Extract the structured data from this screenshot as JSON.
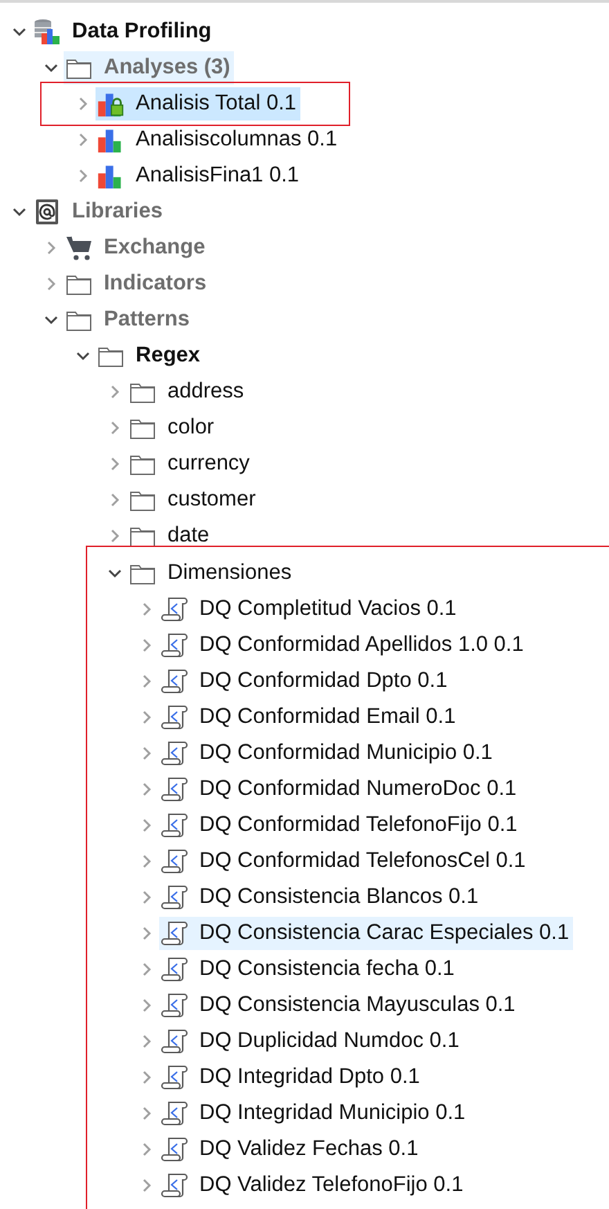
{
  "tree": [
    {
      "label": "Data Profiling",
      "kind": "profiling",
      "bold": true,
      "dimmed": false,
      "expanded": true,
      "selected": false,
      "hovered": false,
      "outlined": false,
      "children": [
        {
          "label": "Analyses (3)",
          "kind": "folder",
          "bold": true,
          "dimmed": true,
          "expanded": true,
          "selected": false,
          "hovered": true,
          "outlined": false,
          "children": [
            {
              "label": "Analisis Total 0.1",
              "kind": "analysis",
              "locked": true,
              "bold": false,
              "dimmed": false,
              "expanded": false,
              "selected": true,
              "hovered": false,
              "outlined": true
            },
            {
              "label": "Analisiscolumnas 0.1",
              "kind": "analysis",
              "locked": false,
              "bold": false,
              "dimmed": false,
              "expanded": false,
              "selected": false,
              "hovered": false,
              "outlined": false
            },
            {
              "label": "AnalisisFina1 0.1",
              "kind": "analysis",
              "locked": false,
              "bold": false,
              "dimmed": false,
              "expanded": false,
              "selected": false,
              "hovered": false,
              "outlined": false
            }
          ]
        }
      ]
    },
    {
      "label": "Libraries",
      "kind": "library",
      "bold": true,
      "dimmed": true,
      "expanded": true,
      "selected": false,
      "hovered": false,
      "outlined": false,
      "children": [
        {
          "label": "Exchange",
          "kind": "cart",
          "bold": true,
          "dimmed": true,
          "expanded": false,
          "selected": false,
          "hovered": false,
          "outlined": false
        },
        {
          "label": "Indicators",
          "kind": "folder",
          "bold": true,
          "dimmed": true,
          "expanded": false,
          "selected": false,
          "hovered": false,
          "outlined": false
        },
        {
          "label": "Patterns",
          "kind": "folder",
          "bold": true,
          "dimmed": true,
          "expanded": true,
          "selected": false,
          "hovered": false,
          "outlined": false,
          "children": [
            {
              "label": "Regex",
              "kind": "folder",
              "bold": true,
              "dimmed": false,
              "expanded": true,
              "selected": false,
              "hovered": false,
              "outlined": false,
              "children": [
                {
                  "label": "address",
                  "kind": "folder",
                  "bold": false,
                  "dimmed": false,
                  "expanded": false,
                  "selected": false,
                  "hovered": false,
                  "outlined": false
                },
                {
                  "label": "color",
                  "kind": "folder",
                  "bold": false,
                  "dimmed": false,
                  "expanded": false,
                  "selected": false,
                  "hovered": false,
                  "outlined": false
                },
                {
                  "label": "currency",
                  "kind": "folder",
                  "bold": false,
                  "dimmed": false,
                  "expanded": false,
                  "selected": false,
                  "hovered": false,
                  "outlined": false
                },
                {
                  "label": "customer",
                  "kind": "folder",
                  "bold": false,
                  "dimmed": false,
                  "expanded": false,
                  "selected": false,
                  "hovered": false,
                  "outlined": false
                },
                {
                  "label": "date",
                  "kind": "folder",
                  "bold": false,
                  "dimmed": false,
                  "expanded": false,
                  "selected": false,
                  "hovered": false,
                  "outlined": false
                },
                {
                  "label": "Dimensiones",
                  "kind": "folder",
                  "bold": false,
                  "dimmed": false,
                  "expanded": true,
                  "selected": false,
                  "hovered": false,
                  "outlined": true,
                  "children": [
                    {
                      "label": "DQ Completitud Vacios 0.1",
                      "kind": "pattern",
                      "bold": false,
                      "dimmed": false,
                      "expanded": false,
                      "selected": false,
                      "hovered": false,
                      "outlined": false
                    },
                    {
                      "label": "DQ Conformidad Apellidos 1.0 0.1",
                      "kind": "pattern",
                      "bold": false,
                      "dimmed": false,
                      "expanded": false,
                      "selected": false,
                      "hovered": false,
                      "outlined": false
                    },
                    {
                      "label": "DQ Conformidad Dpto 0.1",
                      "kind": "pattern",
                      "bold": false,
                      "dimmed": false,
                      "expanded": false,
                      "selected": false,
                      "hovered": false,
                      "outlined": false
                    },
                    {
                      "label": "DQ Conformidad Email 0.1",
                      "kind": "pattern",
                      "bold": false,
                      "dimmed": false,
                      "expanded": false,
                      "selected": false,
                      "hovered": false,
                      "outlined": false
                    },
                    {
                      "label": "DQ Conformidad Municipio 0.1",
                      "kind": "pattern",
                      "bold": false,
                      "dimmed": false,
                      "expanded": false,
                      "selected": false,
                      "hovered": false,
                      "outlined": false
                    },
                    {
                      "label": "DQ Conformidad NumeroDoc 0.1",
                      "kind": "pattern",
                      "bold": false,
                      "dimmed": false,
                      "expanded": false,
                      "selected": false,
                      "hovered": false,
                      "outlined": false
                    },
                    {
                      "label": "DQ Conformidad TelefonoFijo 0.1",
                      "kind": "pattern",
                      "bold": false,
                      "dimmed": false,
                      "expanded": false,
                      "selected": false,
                      "hovered": false,
                      "outlined": false
                    },
                    {
                      "label": "DQ Conformidad TelefonosCel 0.1",
                      "kind": "pattern",
                      "bold": false,
                      "dimmed": false,
                      "expanded": false,
                      "selected": false,
                      "hovered": false,
                      "outlined": false
                    },
                    {
                      "label": "DQ Consistencia Blancos 0.1",
                      "kind": "pattern",
                      "bold": false,
                      "dimmed": false,
                      "expanded": false,
                      "selected": false,
                      "hovered": false,
                      "outlined": false
                    },
                    {
                      "label": "DQ Consistencia Carac Especiales 0.1",
                      "kind": "pattern",
                      "bold": false,
                      "dimmed": false,
                      "expanded": false,
                      "selected": false,
                      "hovered": true,
                      "outlined": false
                    },
                    {
                      "label": "DQ Consistencia fecha 0.1",
                      "kind": "pattern",
                      "bold": false,
                      "dimmed": false,
                      "expanded": false,
                      "selected": false,
                      "hovered": false,
                      "outlined": false
                    },
                    {
                      "label": "DQ Consistencia Mayusculas 0.1",
                      "kind": "pattern",
                      "bold": false,
                      "dimmed": false,
                      "expanded": false,
                      "selected": false,
                      "hovered": false,
                      "outlined": false
                    },
                    {
                      "label": "DQ Duplicidad Numdoc 0.1",
                      "kind": "pattern",
                      "bold": false,
                      "dimmed": false,
                      "expanded": false,
                      "selected": false,
                      "hovered": false,
                      "outlined": false
                    },
                    {
                      "label": "DQ Integridad Dpto 0.1",
                      "kind": "pattern",
                      "bold": false,
                      "dimmed": false,
                      "expanded": false,
                      "selected": false,
                      "hovered": false,
                      "outlined": false
                    },
                    {
                      "label": "DQ Integridad Municipio 0.1",
                      "kind": "pattern",
                      "bold": false,
                      "dimmed": false,
                      "expanded": false,
                      "selected": false,
                      "hovered": false,
                      "outlined": false
                    },
                    {
                      "label": "DQ Validez Fechas 0.1",
                      "kind": "pattern",
                      "bold": false,
                      "dimmed": false,
                      "expanded": false,
                      "selected": false,
                      "hovered": false,
                      "outlined": false
                    },
                    {
                      "label": "DQ Validez TelefonoFijo 0.1",
                      "kind": "pattern",
                      "bold": false,
                      "dimmed": false,
                      "expanded": false,
                      "selected": false,
                      "hovered": false,
                      "outlined": false
                    }
                  ]
                }
              ]
            }
          ]
        }
      ]
    }
  ]
}
